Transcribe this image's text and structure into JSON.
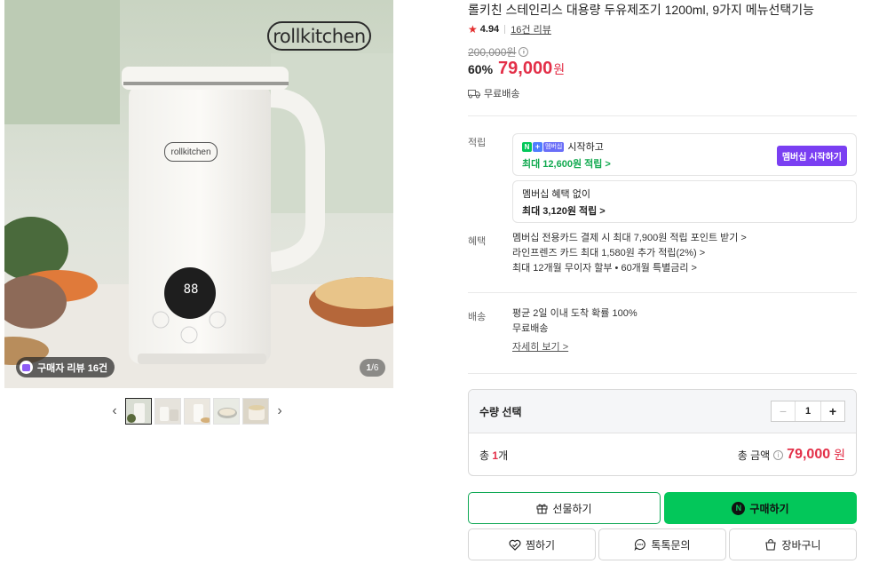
{
  "gallery": {
    "brand_logo": "rollkitchen",
    "product_label": "rollkitchen",
    "display_digits": "88",
    "review_chip": "구매자 리뷰 16건",
    "counter_current": "1",
    "counter_total": "/6",
    "prev_arrow": "‹",
    "next_arrow": "›"
  },
  "product": {
    "title": "롤키친 스테인리스 대용량 두유제조기 1200ml, 9가지 메뉴선택기능",
    "rating": "4.94",
    "review_link": "16건 리뷰",
    "original_price": "200,000원",
    "discount": "60%",
    "price": "79,000",
    "currency": "원",
    "shipping": "무료배송"
  },
  "points": {
    "label": "적립",
    "box1_prefix": "멤버십",
    "box1_line1": "시작하고",
    "box1_line2": "최대 12,600원 적립 >",
    "membership_button": "멤버십 시작하기",
    "box2_line1": "멤버십 혜택 없이",
    "box2_line2": "최대 3,120원 적립 >"
  },
  "benefits": {
    "label": "혜택",
    "items": [
      "멤버십 전용카드 결제 시 최대 7,900원 적립 포인트 받기 >",
      "라인프렌즈 카드 최대 1,580원 추가 적립(2%) >",
      "최대 12개월 무이자 할부 • 60개월 특별금리 >"
    ]
  },
  "delivery": {
    "label": "배송",
    "line1": "평균 2일 이내 도착 확률 100%",
    "line2": "무료배송",
    "detail_link": "자세히 보기 >"
  },
  "quantity": {
    "label": "수량 선택",
    "minus": "−",
    "value": "1",
    "plus": "+",
    "total_prefix": "총 ",
    "total_count": "1",
    "total_suffix": "개",
    "total_amount_label": "총 금액",
    "total_price": "79,000",
    "total_currency": "원"
  },
  "actions": {
    "gift": "선물하기",
    "buy": "구매하기",
    "wish": "찜하기",
    "talk": "톡톡문의",
    "cart": "장바구니"
  },
  "colors": {
    "accent_red": "#e32f48",
    "naver_green": "#03c75a",
    "membership_purple": "#7a3ff2"
  }
}
